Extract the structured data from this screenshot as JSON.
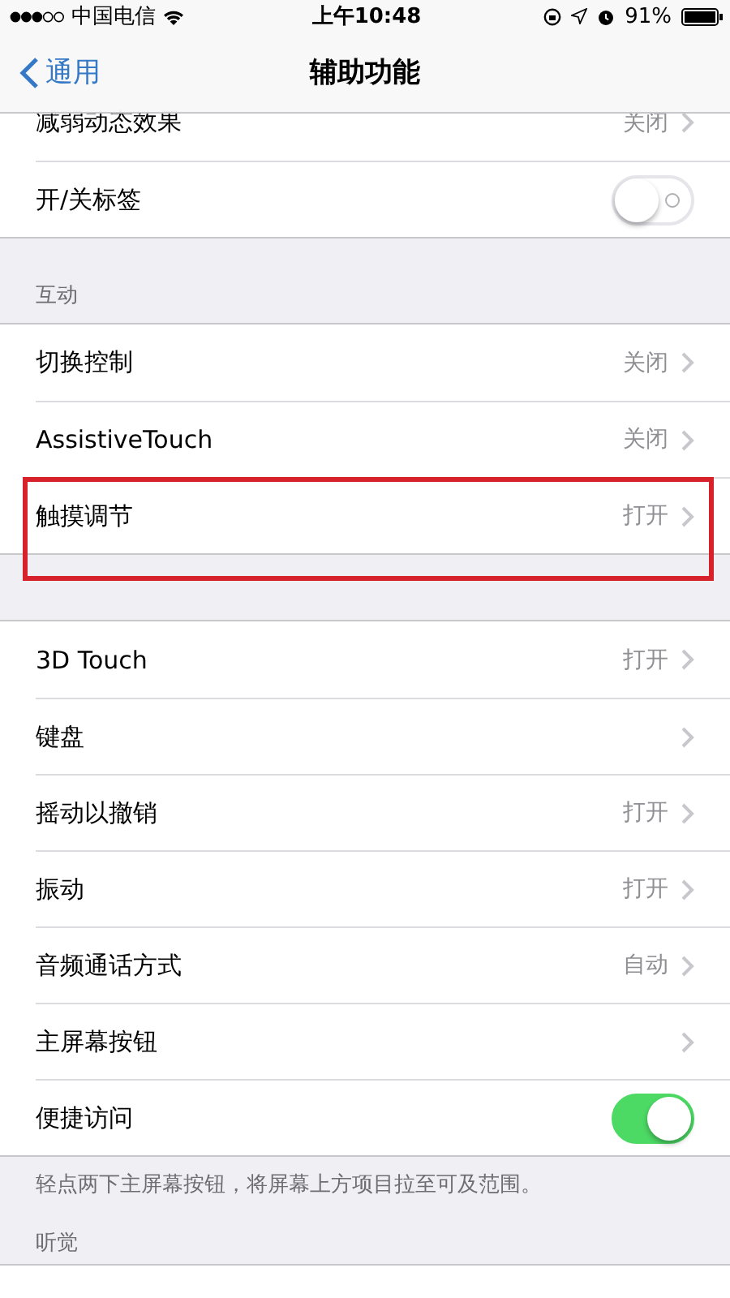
{
  "status_bar": {
    "carrier": "中国电信",
    "time": "上午10:48",
    "battery": "91%"
  },
  "nav": {
    "back": "通用",
    "title": "辅助功能"
  },
  "groups": [
    {
      "items": [
        {
          "kind": "value",
          "label": "减弱动态效果",
          "value": "关闭",
          "highlighted": false
        },
        {
          "kind": "toggle",
          "label": "开/关标签",
          "on": false,
          "highlighted": false
        }
      ]
    },
    {
      "header": "互动",
      "items": [
        {
          "kind": "value",
          "label": "切换控制",
          "value": "关闭",
          "highlighted": false
        },
        {
          "kind": "value",
          "label": "AssistiveTouch",
          "value": "关闭",
          "highlighted": false
        },
        {
          "kind": "value",
          "label": "触摸调节",
          "value": "打开",
          "highlighted": true
        }
      ]
    },
    {
      "items": [
        {
          "kind": "value",
          "label": "3D Touch",
          "value": "打开",
          "highlighted": false
        },
        {
          "kind": "value",
          "label": "键盘",
          "highlighted": false
        },
        {
          "kind": "value",
          "label": "摇动以撤销",
          "value": "打开",
          "highlighted": false
        },
        {
          "kind": "value",
          "label": "振动",
          "value": "打开",
          "highlighted": false
        },
        {
          "kind": "value",
          "label": "音频通话方式",
          "value": "自动",
          "highlighted": false
        },
        {
          "kind": "value",
          "label": "主屏幕按钮",
          "highlighted": false
        },
        {
          "kind": "toggle",
          "label": "便捷访问",
          "on": true,
          "highlighted": false
        }
      ],
      "footer": "轻点两下主屏幕按钮，将屏幕上方项目拉至可及范围。"
    },
    {
      "header": "听觉"
    }
  ]
}
